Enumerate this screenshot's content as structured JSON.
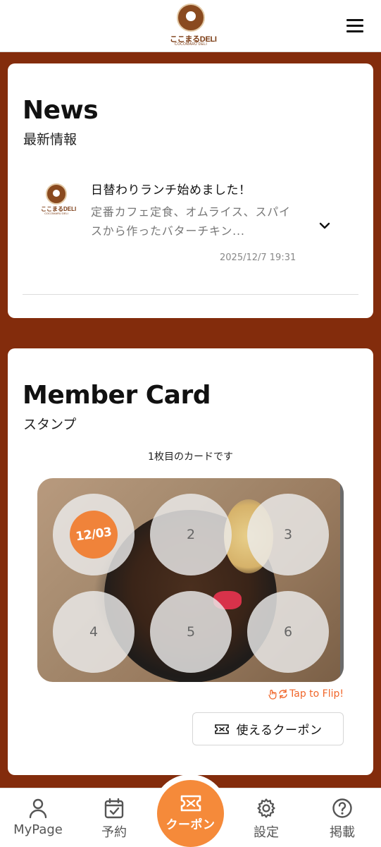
{
  "header": {
    "logo_text": "ここまるDELI",
    "logo_sub": "COCOMARU DELI",
    "menu_icon": "hamburger-menu-icon"
  },
  "news": {
    "title": "News",
    "subtitle": "最新情報",
    "items": [
      {
        "logo_text": "ここまるDELI",
        "logo_sub": "COCOMARU DELI",
        "title": "日替わりランチ始めました！",
        "body": "定番カフェ定食、オムライス、スパイスから作ったバターチキン...",
        "date": "2025/12/7 19:31",
        "expand_icon": "chevron-down-icon"
      }
    ]
  },
  "member_card": {
    "title": "Member Card",
    "subtitle": "スタンプ",
    "card_count_text": "1枚目のカードです",
    "stamps": [
      {
        "label": "12/03",
        "filled": true
      },
      {
        "label": "2",
        "filled": false
      },
      {
        "label": "3",
        "filled": false
      },
      {
        "label": "4",
        "filled": false
      },
      {
        "label": "5",
        "filled": false
      },
      {
        "label": "6",
        "filled": false
      }
    ],
    "flip_hint": "Tap to Flip!",
    "coupon_button": "使えるクーポン"
  },
  "nav": {
    "items": [
      {
        "label": "MyPage",
        "icon": "user-icon"
      },
      {
        "label": "予約",
        "icon": "calendar-check-icon"
      },
      {
        "label": "クーポン",
        "icon": "ticket-icon"
      },
      {
        "label": "設定",
        "icon": "gear-icon"
      },
      {
        "label": "掲載",
        "icon": "help-circle-icon"
      }
    ]
  },
  "colors": {
    "background": "#832c0c",
    "accent": "#f58a3a",
    "stamp_fill": "#f0833a",
    "flip_hint": "#f0662a"
  }
}
